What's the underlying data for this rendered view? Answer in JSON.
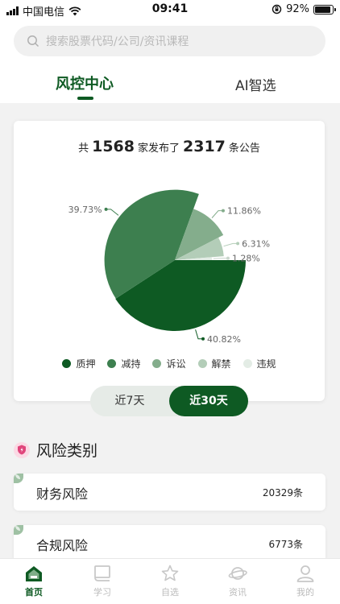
{
  "status_bar": {
    "carrier": "中国电信",
    "time": "09:41",
    "battery": "92%",
    "battery_level": 0.92
  },
  "search": {
    "placeholder": "搜索股票代码/公司/资讯课程"
  },
  "tabs": [
    {
      "label": "风控中心",
      "active": true
    },
    {
      "label": "AI智选",
      "active": false
    }
  ],
  "summary": {
    "prefix": "共",
    "companies": "1568",
    "middle": "家发布了",
    "announcements": "2317",
    "suffix": "条公告"
  },
  "chart_data": {
    "type": "pie",
    "title": "",
    "categories": [
      "质押",
      "减持",
      "诉讼",
      "解禁",
      "违规"
    ],
    "values": [
      40.82,
      39.73,
      11.86,
      6.31,
      1.28
    ],
    "labels": [
      "40.82%",
      "39.73%",
      "11.86%",
      "6.31%",
      "1.28%"
    ],
    "colors": [
      "#0e5a23",
      "#3d7f4f",
      "#84ad8c",
      "#b3cdb8",
      "#e3ece5"
    ],
    "legend_position": "bottom"
  },
  "range_toggle": [
    {
      "label": "近7天",
      "active": false
    },
    {
      "label": "近30天",
      "active": true
    }
  ],
  "risk_section": {
    "title": "风险类别",
    "items": [
      {
        "name": "财务风险",
        "count": "20329条"
      },
      {
        "name": "合规风险",
        "count": "6773条"
      }
    ]
  },
  "tabbar": [
    {
      "label": "首页",
      "icon": "home-icon",
      "active": true
    },
    {
      "label": "学习",
      "icon": "book-icon",
      "active": false
    },
    {
      "label": "自选",
      "icon": "star-icon",
      "active": false
    },
    {
      "label": "资讯",
      "icon": "planet-icon",
      "active": false
    },
    {
      "label": "我的",
      "icon": "user-icon",
      "active": false
    }
  ],
  "colors": {
    "brand": "#0e5a23",
    "accent_pink": "#e0457b"
  }
}
